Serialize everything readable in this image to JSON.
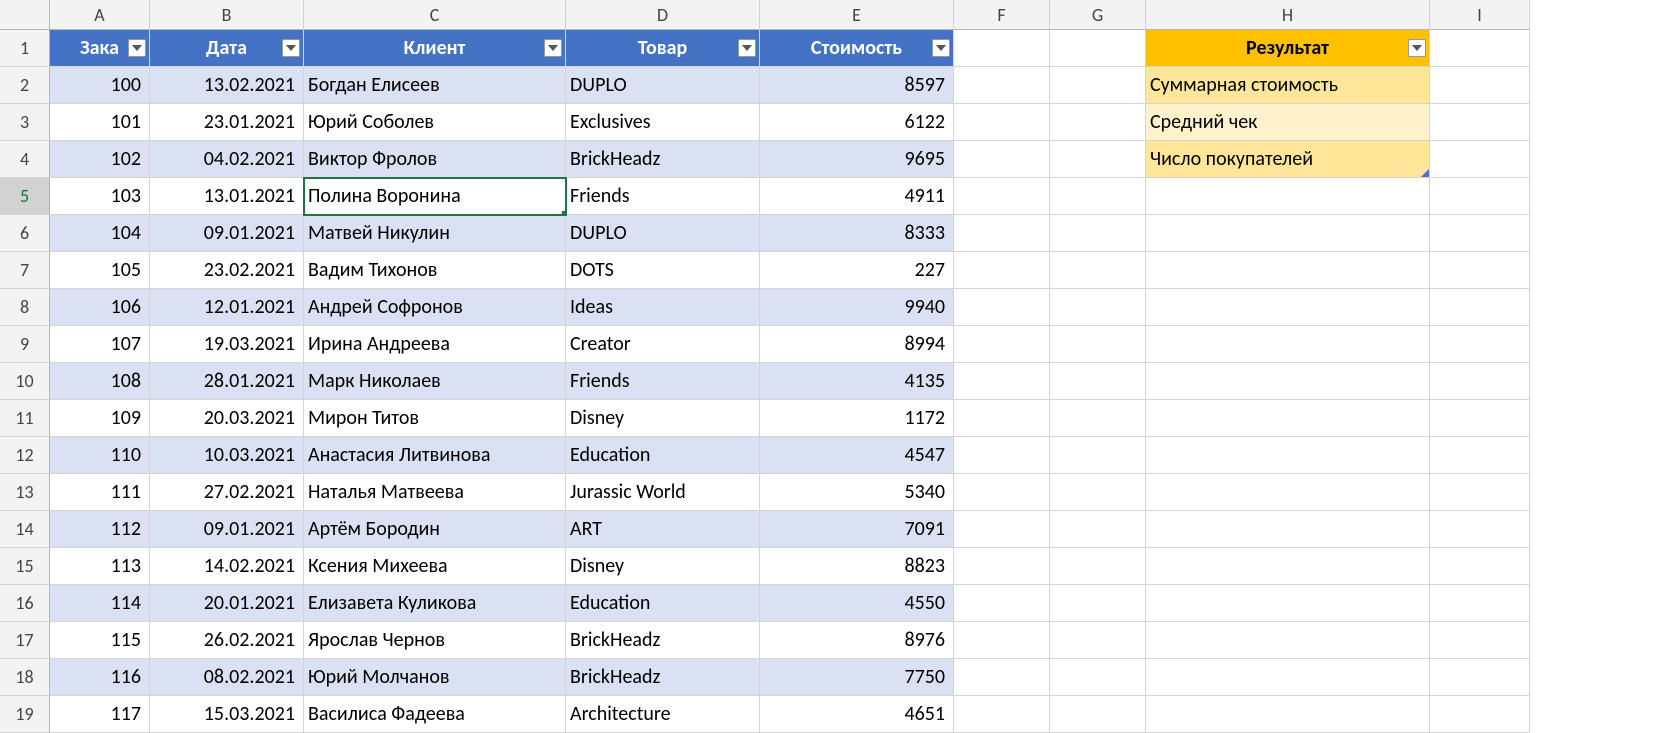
{
  "columns": [
    "A",
    "B",
    "C",
    "D",
    "E",
    "F",
    "G",
    "H",
    "I"
  ],
  "headers_blue": {
    "A": "Зака",
    "B": "Дата",
    "C": "Клиент",
    "D": "Товар",
    "E": "Стоимость"
  },
  "header_yellow": "Результат",
  "result_rows": [
    "Суммарная стоимость",
    "Средний чек",
    "Число покупателей"
  ],
  "rows": [
    {
      "n": 2,
      "A": "100",
      "B": "13.02.2021",
      "C": "Богдан Елисеев",
      "D": "DUPLO",
      "E": "8597"
    },
    {
      "n": 3,
      "A": "101",
      "B": "23.01.2021",
      "C": "Юрий Соболев",
      "D": "Exclusives",
      "E": "6122"
    },
    {
      "n": 4,
      "A": "102",
      "B": "04.02.2021",
      "C": "Виктор Фролов",
      "D": "BrickHeadz",
      "E": "9695"
    },
    {
      "n": 5,
      "A": "103",
      "B": "13.01.2021",
      "C": "Полина Воронина",
      "D": "Friends",
      "E": "4911"
    },
    {
      "n": 6,
      "A": "104",
      "B": "09.01.2021",
      "C": "Матвей Никулин",
      "D": "DUPLO",
      "E": "8333"
    },
    {
      "n": 7,
      "A": "105",
      "B": "23.02.2021",
      "C": "Вадим Тихонов",
      "D": "DOTS",
      "E": "227"
    },
    {
      "n": 8,
      "A": "106",
      "B": "12.01.2021",
      "C": "Андрей Софронов",
      "D": "Ideas",
      "E": "9940"
    },
    {
      "n": 9,
      "A": "107",
      "B": "19.03.2021",
      "C": "Ирина Андреева",
      "D": "Creator",
      "E": "8994"
    },
    {
      "n": 10,
      "A": "108",
      "B": "28.01.2021",
      "C": "Марк Николаев",
      "D": "Friends",
      "E": "4135"
    },
    {
      "n": 11,
      "A": "109",
      "B": "20.03.2021",
      "C": "Мирон Титов",
      "D": "Disney",
      "E": "1172"
    },
    {
      "n": 12,
      "A": "110",
      "B": "10.03.2021",
      "C": "Анастасия Литвинова",
      "D": "Education",
      "E": "4547"
    },
    {
      "n": 13,
      "A": "111",
      "B": "27.02.2021",
      "C": "Наталья Матвеева",
      "D": "Jurassic World",
      "E": "5340"
    },
    {
      "n": 14,
      "A": "112",
      "B": "09.01.2021",
      "C": "Артём Бородин",
      "D": "ART",
      "E": "7091"
    },
    {
      "n": 15,
      "A": "113",
      "B": "14.02.2021",
      "C": "Ксения Михеева",
      "D": "Disney",
      "E": "8823"
    },
    {
      "n": 16,
      "A": "114",
      "B": "20.01.2021",
      "C": "Елизавета Куликова",
      "D": "Education",
      "E": "4550"
    },
    {
      "n": 17,
      "A": "115",
      "B": "26.02.2021",
      "C": "Ярослав Чернов",
      "D": "BrickHeadz",
      "E": "8976"
    },
    {
      "n": 18,
      "A": "116",
      "B": "08.02.2021",
      "C": "Юрий Молчанов",
      "D": "BrickHeadz",
      "E": "7750"
    },
    {
      "n": 19,
      "A": "117",
      "B": "15.03.2021",
      "C": "Василиса Фадеева",
      "D": "Architecture",
      "E": "4651"
    }
  ],
  "active_row": 5
}
